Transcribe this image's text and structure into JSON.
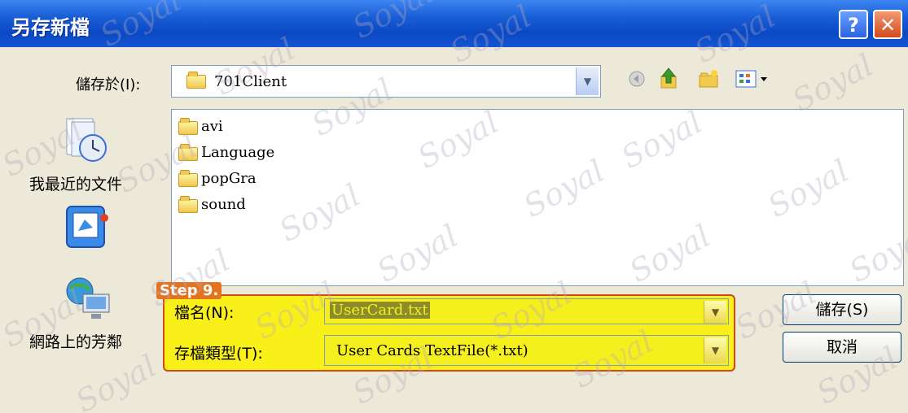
{
  "window": {
    "title": "另存新檔",
    "help_label": "?",
    "close_label": "✕"
  },
  "lookin": {
    "label": "儲存於(I):",
    "value": "701Client"
  },
  "places": {
    "recent": "我最近的文件",
    "network": "網路上的芳鄰"
  },
  "files": [
    {
      "name": "avi"
    },
    {
      "name": "Language"
    },
    {
      "name": "popGra"
    },
    {
      "name": "sound"
    }
  ],
  "step": {
    "label": "Step 9."
  },
  "filename": {
    "label": "檔名(N):",
    "value": "UserCard.txt"
  },
  "filetype": {
    "label": "存檔類型(T):",
    "value": "User Cards TextFile(*.txt)"
  },
  "buttons": {
    "save": "儲存(S)",
    "cancel": "取消"
  },
  "watermark": {
    "text": "Soyal"
  },
  "colors": {
    "titlebar": "#0a48c4",
    "highlight": "#f9f01a",
    "step_badge": "#e3731e",
    "border_accent": "#d24a1c"
  },
  "icons": [
    "folder-icon",
    "up-folder-icon",
    "new-folder-icon",
    "view-menu-icon",
    "recent-docs-icon",
    "desktop-icon",
    "network-icon"
  ]
}
